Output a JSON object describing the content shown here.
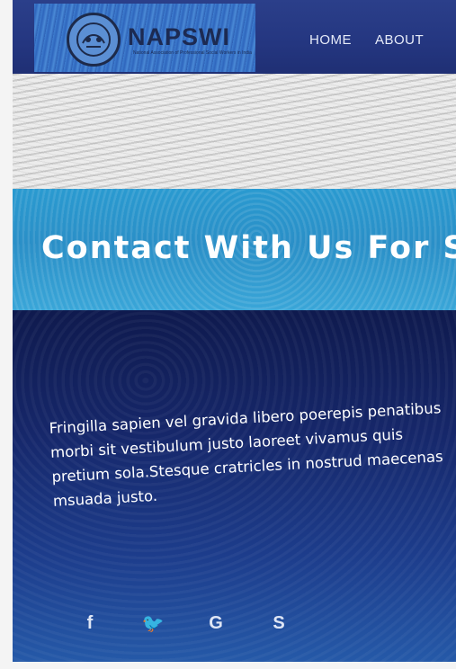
{
  "header": {
    "logo_text": "NAPSWI",
    "logo_subtext": "National Association of Professional Social Workers in India",
    "nav": [
      "HOME",
      "ABOUT"
    ]
  },
  "title_band": {
    "title": "Contact With Us For S"
  },
  "main": {
    "description": "Fringilla sapien vel gravida libero poerepis penatibus morbi sit vestibulum justo laoreet vivamus quis pretium sola.Stesque cratricles in nostrud maecenas msuada justo."
  },
  "social": [
    {
      "icon": "facebook-icon",
      "glyph": "f"
    },
    {
      "icon": "twitter-icon",
      "glyph": "🐦"
    },
    {
      "icon": "google-icon",
      "glyph": "G"
    },
    {
      "icon": "skype-icon",
      "glyph": "S"
    }
  ],
  "colors": {
    "header_bg": "#2b3f8a",
    "title_band": "#2a9ad0",
    "dark_band": "#16276a",
    "text": "#ffffff"
  }
}
